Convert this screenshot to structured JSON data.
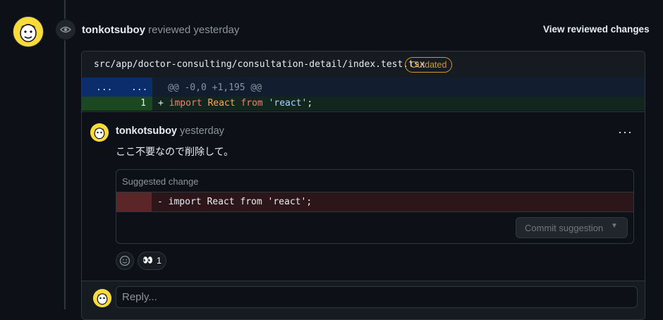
{
  "review": {
    "username": "tonkotsuboy",
    "action": "reviewed yesterday",
    "view_changes_label": "View reviewed changes"
  },
  "file": {
    "path": "src/app/doctor-consulting/consultation-detail/index.test.tsx",
    "badge": "Outdated"
  },
  "diff": {
    "hunk_left": "...",
    "hunk_right": "...",
    "hunk_header": "@@ -0,0 +1,195 @@",
    "line_number": "1",
    "added_line": {
      "prefix": "+",
      "kw1": "import",
      "ident": "React",
      "kw2": "from",
      "string": "'react'",
      "end": ";"
    }
  },
  "comment": {
    "username": "tonkotsuboy",
    "time": "yesterday",
    "menu": "···",
    "body": "ここ不要なので削除して。",
    "suggestion": {
      "title": "Suggested change",
      "removed_line": "- import React from 'react';",
      "commit_label": "Commit suggestion"
    },
    "reactions": [
      {
        "emoji": "👀",
        "count": "1"
      }
    ]
  },
  "reply": {
    "placeholder": "Reply..."
  },
  "colors": {
    "background": "#0d1117",
    "border": "#30363d",
    "outdated": "#d29922",
    "added_bg": "#1b4721",
    "removed_bg": "#5c2528",
    "hunk_bg": "#0c2d6b"
  }
}
